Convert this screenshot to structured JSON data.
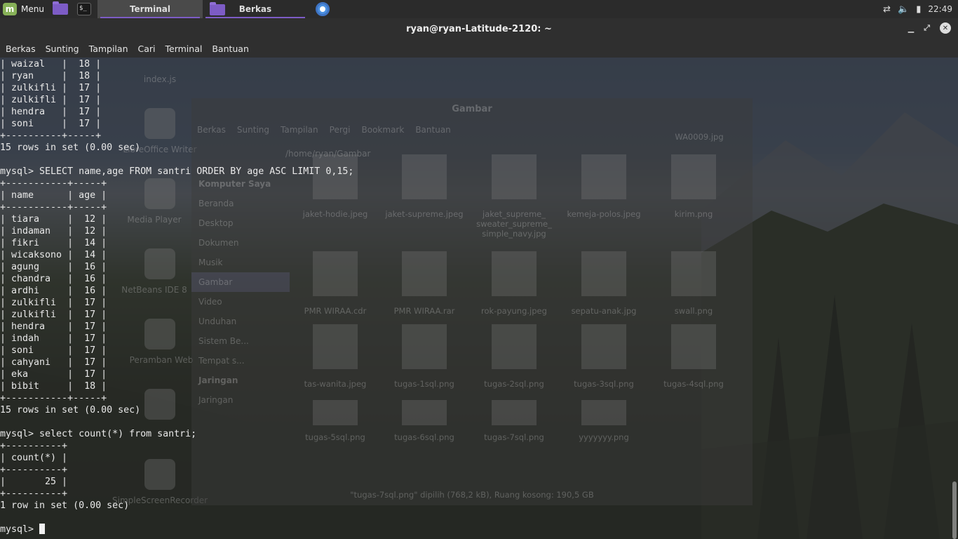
{
  "taskbar": {
    "menu_label": "Menu",
    "tasks": [
      {
        "label": "Terminal",
        "icon": "terminal-icon",
        "active": true
      },
      {
        "label": "Berkas",
        "icon": "folder-icon",
        "active": false
      }
    ],
    "clock": "22:49"
  },
  "window": {
    "title": "ryan@ryan-Latitude-2120: ~",
    "menu": [
      "Berkas",
      "Sunting",
      "Tampilan",
      "Cari",
      "Terminal",
      "Bantuan"
    ]
  },
  "terminal": {
    "lines": [
      "| waizal   |  18 |",
      "| ryan     |  18 |",
      "| zulkifli |  17 |",
      "| zulkifli |  17 |",
      "| hendra   |  17 |",
      "| soni     |  17 |",
      "+----------+-----+",
      "15 rows in set (0.00 sec)",
      "",
      "mysql> SELECT name,age FROM santri ORDER BY age ASC LIMIT 0,15;",
      "+-----------+-----+",
      "| name      | age |",
      "+-----------+-----+",
      "| tiara     |  12 |",
      "| indaman   |  12 |",
      "| fikri     |  14 |",
      "| wicaksono |  14 |",
      "| agung     |  16 |",
      "| chandra   |  16 |",
      "| ardhi     |  16 |",
      "| zulkifli  |  17 |",
      "| zulkifli  |  17 |",
      "| hendra    |  17 |",
      "| indah     |  17 |",
      "| soni      |  17 |",
      "| cahyani   |  17 |",
      "| eka       |  17 |",
      "| bibit     |  18 |",
      "+-----------+-----+",
      "15 rows in set (0.00 sec)",
      "",
      "mysql> select count(*) from santri;",
      "+----------+",
      "| count(*) |",
      "+----------+",
      "|       25 |",
      "+----------+",
      "1 row in set (0.00 sec)",
      ""
    ],
    "prompt": "mysql> "
  },
  "background_file_manager": {
    "title": "Gambar",
    "menu": [
      "Berkas",
      "Sunting",
      "Tampilan",
      "Pergi",
      "Bookmark",
      "Bantuan"
    ],
    "path": "/home/ryan/Gambar",
    "sidebar": [
      "Komputer Saya",
      "Beranda",
      "Desktop",
      "Dokumen",
      "Musik",
      "Gambar",
      "Video",
      "Unduhan",
      "Sistem Be...",
      "Tempat s...",
      "Jaringan",
      "Jaringan"
    ],
    "files": [
      "WA0009.jpg",
      "jaket-hodie.jpeg",
      "jaket-supreme.jpeg",
      "jaket_supreme_ sweater_supreme_ simple_navy.jpg",
      "kemeja-polos.jpeg",
      "kirim.png",
      "PMR WIRAA.cdr",
      "PMR WIRAA.rar",
      "rok-payung.jpeg",
      "sepatu-anak.jpg",
      "swall.png",
      "tas-wanita.jpeg",
      "tugas-1sql.png",
      "tugas-2sql.png",
      "tugas-3sql.png",
      "tugas-4sql.png",
      "tugas-5sql.png",
      "tugas-6sql.png",
      "tugas-7sql.png",
      "yyyyyyy.png"
    ],
    "status": "\"tugas-7sql.png\" dipilih (768,2 kB), Ruang kosong: 190,5 GB"
  },
  "desktop_icons": [
    "index.js",
    "LibreOffice Writer",
    "Media Player",
    "NetBeans IDE 8",
    "Peramban Web",
    "SimpleScreenRecorder"
  ],
  "colors": {
    "accent": "#7d5cc6",
    "terminal_bg": "#262626",
    "text": "#e9e9e9"
  }
}
